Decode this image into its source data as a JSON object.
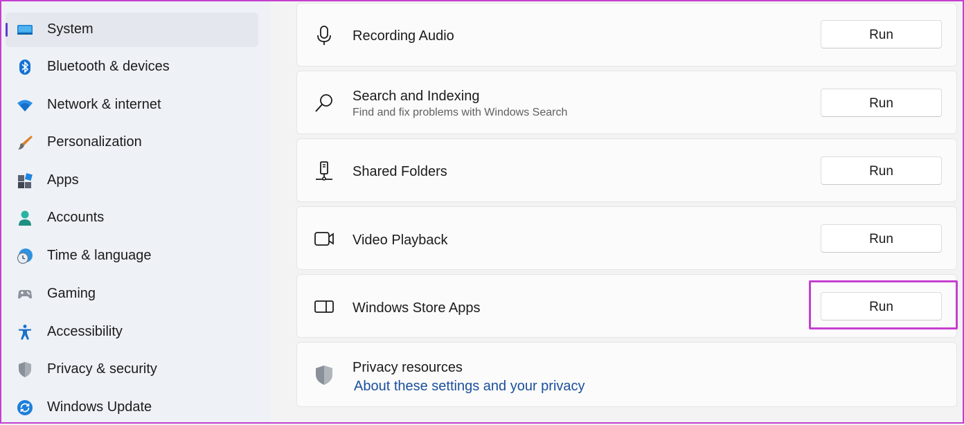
{
  "sidebar": {
    "items": [
      {
        "label": "System",
        "icon": "laptop-icon",
        "selected": true
      },
      {
        "label": "Bluetooth & devices",
        "icon": "bluetooth-icon"
      },
      {
        "label": "Network & internet",
        "icon": "wifi-icon"
      },
      {
        "label": "Personalization",
        "icon": "brush-icon"
      },
      {
        "label": "Apps",
        "icon": "apps-icon"
      },
      {
        "label": "Accounts",
        "icon": "person-icon"
      },
      {
        "label": "Time & language",
        "icon": "clock-globe-icon"
      },
      {
        "label": "Gaming",
        "icon": "gamepad-icon"
      },
      {
        "label": "Accessibility",
        "icon": "accessibility-icon"
      },
      {
        "label": "Privacy & security",
        "icon": "shield-icon"
      },
      {
        "label": "Windows Update",
        "icon": "update-icon"
      }
    ]
  },
  "troubleshooters": [
    {
      "title": "Recording Audio",
      "icon": "microphone-icon",
      "button": "Run"
    },
    {
      "title": "Search and Indexing",
      "subtitle": "Find and fix problems with Windows Search",
      "icon": "search-icon",
      "button": "Run"
    },
    {
      "title": "Shared Folders",
      "icon": "shared-folder-icon",
      "button": "Run"
    },
    {
      "title": "Video Playback",
      "icon": "video-camera-icon",
      "button": "Run"
    },
    {
      "title": "Windows Store Apps",
      "icon": "store-apps-icon",
      "button": "Run",
      "highlighted": true
    }
  ],
  "privacy": {
    "title": "Privacy resources",
    "link": "About these settings and your privacy",
    "icon": "shield-icon"
  },
  "colors": {
    "accent": "#5c3dcb",
    "highlight_border": "#c53fd0",
    "link": "#1a4f9c"
  }
}
